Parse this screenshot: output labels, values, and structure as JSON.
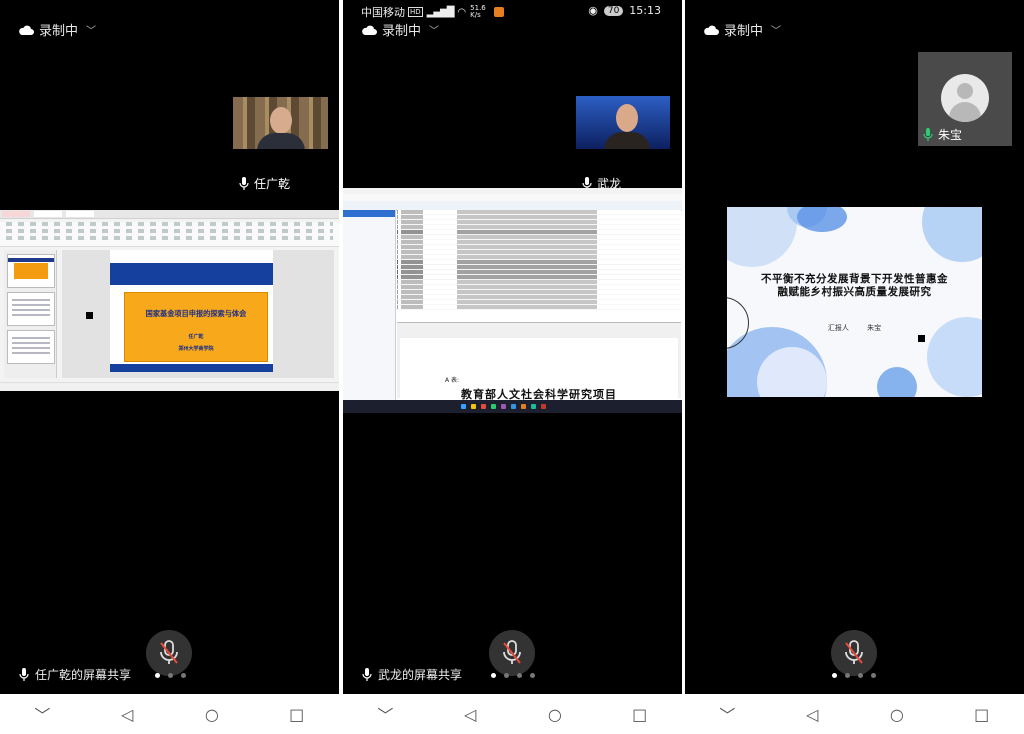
{
  "panels": [
    {
      "recording_label": "录制中",
      "participant_name": "任广乾",
      "share_label": "任广乾的屏幕共享",
      "slide": {
        "title": "国家基金项目申报的探索与体会",
        "author": "任广乾",
        "org": "郑州大学商学院"
      },
      "page_dots": 3,
      "active_dot": 0
    },
    {
      "status_bar": {
        "carrier": "中国移动",
        "hd": "HD",
        "speed": "51.6 K/s",
        "battery": "70",
        "time": "15:13"
      },
      "recording_label": "录制中",
      "participant_name": "武龙",
      "share_label": "武龙的屏幕共享",
      "document": {
        "label_a": "A 表:",
        "heading": "教育部人文社会科学研究项目"
      },
      "page_dots": 4,
      "active_dot": 0
    },
    {
      "recording_label": "录制中",
      "participant_name": "朱宝",
      "slide": {
        "title": "不平衡不充分发展背景下开发性普惠金融赋能乡村振兴高质量发展研究",
        "reporter_label": "汇报人",
        "reporter_name": "朱宝"
      },
      "page_dots": 4,
      "active_dot": 0
    }
  ],
  "nav": {
    "collapse": "﹀",
    "back": "◁",
    "home": "○",
    "recents": "□"
  },
  "colors": {
    "accent_green": "#2ecc71",
    "slide_orange": "#f7a81b",
    "slide_blue": "#15409e"
  }
}
